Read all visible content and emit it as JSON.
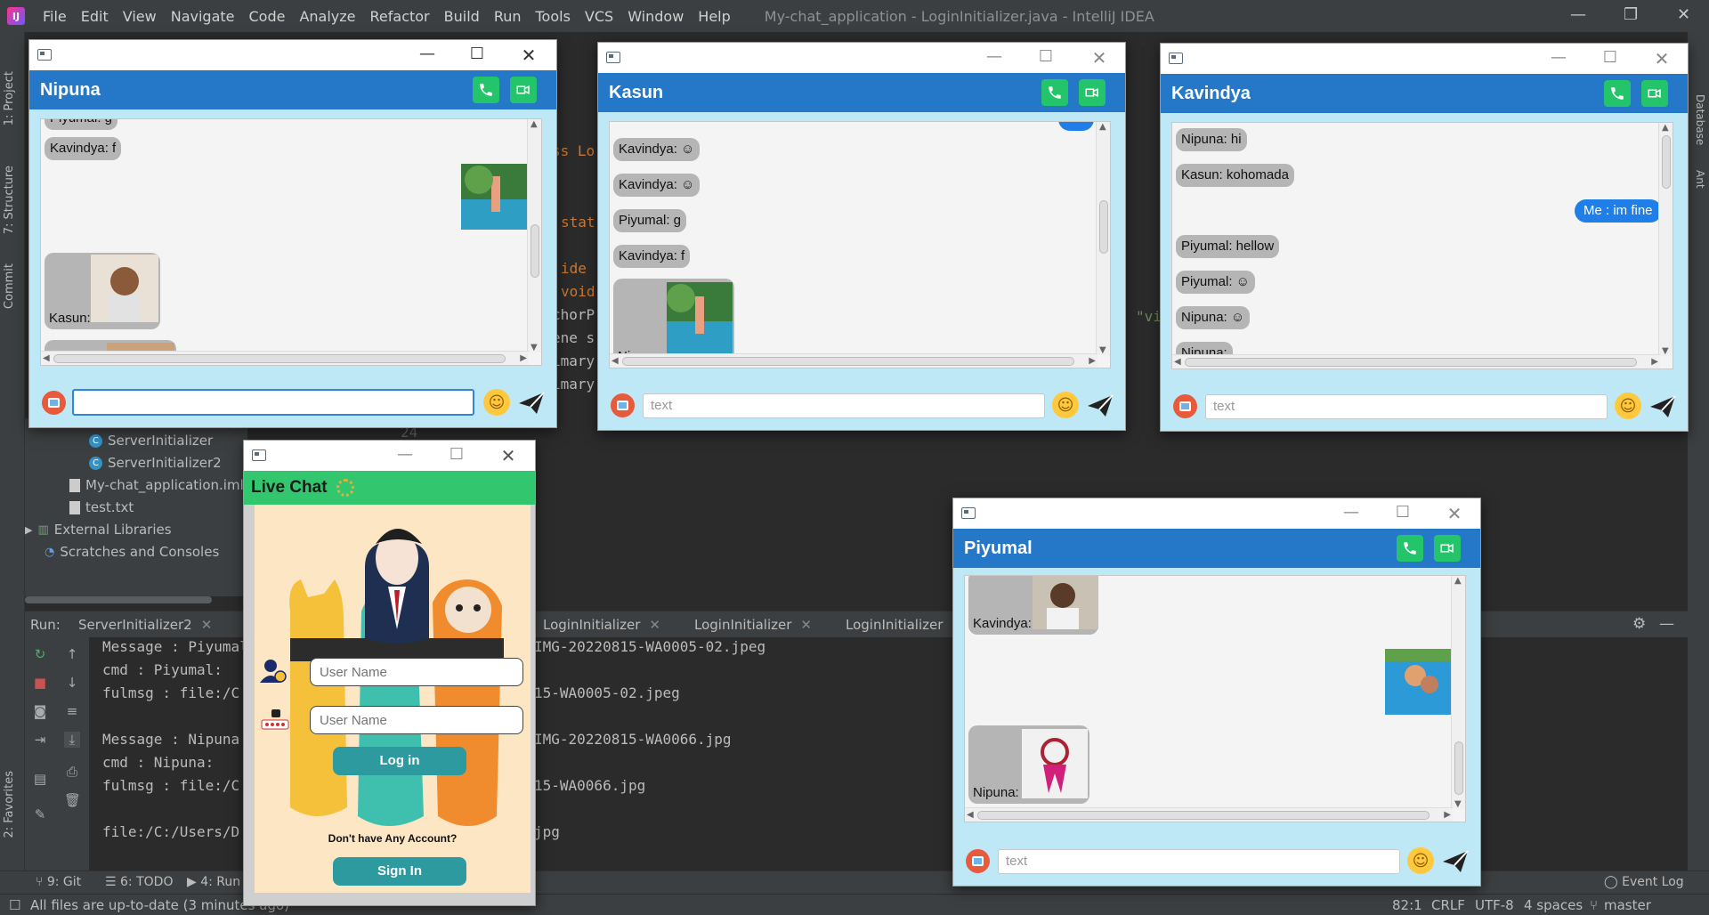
{
  "ide": {
    "menu": [
      "File",
      "Edit",
      "View",
      "Navigate",
      "Code",
      "Analyze",
      "Refactor",
      "Build",
      "Run",
      "Tools",
      "VCS",
      "Window",
      "Help"
    ],
    "title": "My-chat_application - LoginInitializer.java - IntelliJ IDEA",
    "left_tabs": [
      "1: Project",
      "7: Structure",
      "Commit",
      "2: Favorites"
    ],
    "right_tabs": [
      "Database",
      "Ant"
    ],
    "code_fragments": [
      "ss Lo",
      "stat",
      "ide",
      "void",
      "chorP",
      "ene s",
      "imary",
      "imary",
      "24",
      "\"vi"
    ],
    "project_tree": [
      "ServerInitializer",
      "ServerInitializer2",
      "My-chat_application.iml",
      "test.txt",
      "External Libraries",
      "Scratches and Consoles"
    ],
    "run_label": "Run:",
    "run_tabs": [
      "ServerInitializer2",
      "LoginInitializer",
      "LoginInitializer",
      "LoginInitializer"
    ],
    "console": [
      "Message : Piyumal:",
      "cmd : Piyumal:",
      "fulmsg : file:/C",
      "",
      "Message : Nipuna:",
      "cmd : Nipuna:",
      "fulmsg : file:/C",
      "",
      "file:/C:/Users/D"
    ],
    "console_right": [
      "IMG-20220815-WA0005-02.jpeg",
      "",
      "15-WA0005-02.jpeg",
      "",
      "IMG-20220815-WA0066.jpg",
      "",
      "15-WA0066.jpg",
      "",
      "jpg"
    ],
    "bottom_tabs": [
      "9: Git",
      "6: TODO",
      "4: Run"
    ],
    "event_log": "Event Log",
    "status": "All files are up-to-date (3 minutes ago)",
    "status_right": [
      "82:1",
      "CRLF",
      "UTF-8",
      "4 spaces",
      "master"
    ]
  },
  "chats": {
    "nipuna": {
      "name": "Nipuna",
      "messages": [
        {
          "label": "Piyumal: g"
        },
        {
          "label": "Kavindya: f"
        },
        {
          "label": "Kasun:"
        }
      ],
      "input_value": ""
    },
    "kasun": {
      "name": "Kasun",
      "messages": [
        {
          "label": "Kavindya: ☺"
        },
        {
          "label": "Kavindya: ☺"
        },
        {
          "label": "Piyumal: g"
        },
        {
          "label": "Kavindya: f"
        },
        {
          "label": "Nipuna:"
        }
      ],
      "placeholder": "text"
    },
    "kavindya": {
      "name": "Kavindya",
      "messages": [
        {
          "label": "Nipuna: hi"
        },
        {
          "label": "Kasun: kohomada"
        },
        {
          "label": "Me : im fine"
        },
        {
          "label": "Piyumal: hellow"
        },
        {
          "label": "Piyumal: ☺"
        },
        {
          "label": "Nipuna: ☺"
        },
        {
          "label": "Nipuna:"
        }
      ],
      "placeholder": "text"
    },
    "piyumal": {
      "name": "Piyumal",
      "messages": [
        {
          "label": "Kavindya:"
        },
        {
          "label": "Nipuna:"
        }
      ],
      "placeholder": "text"
    }
  },
  "live_chat": {
    "title": "Live Chat",
    "username_placeholder": "User Name",
    "password_placeholder": "User Name",
    "login_label": "Log in",
    "no_account_text": "Don't have Any Account?",
    "signin_label": "Sign In"
  },
  "colors": {
    "header_blue": "#2577c7",
    "live_green": "#32c66e",
    "teal": "#2d9aa0",
    "bubble_grey": "#b5b5b5",
    "me_blue": "#1f7ee8",
    "chat_bg": "#bfe8f7"
  }
}
